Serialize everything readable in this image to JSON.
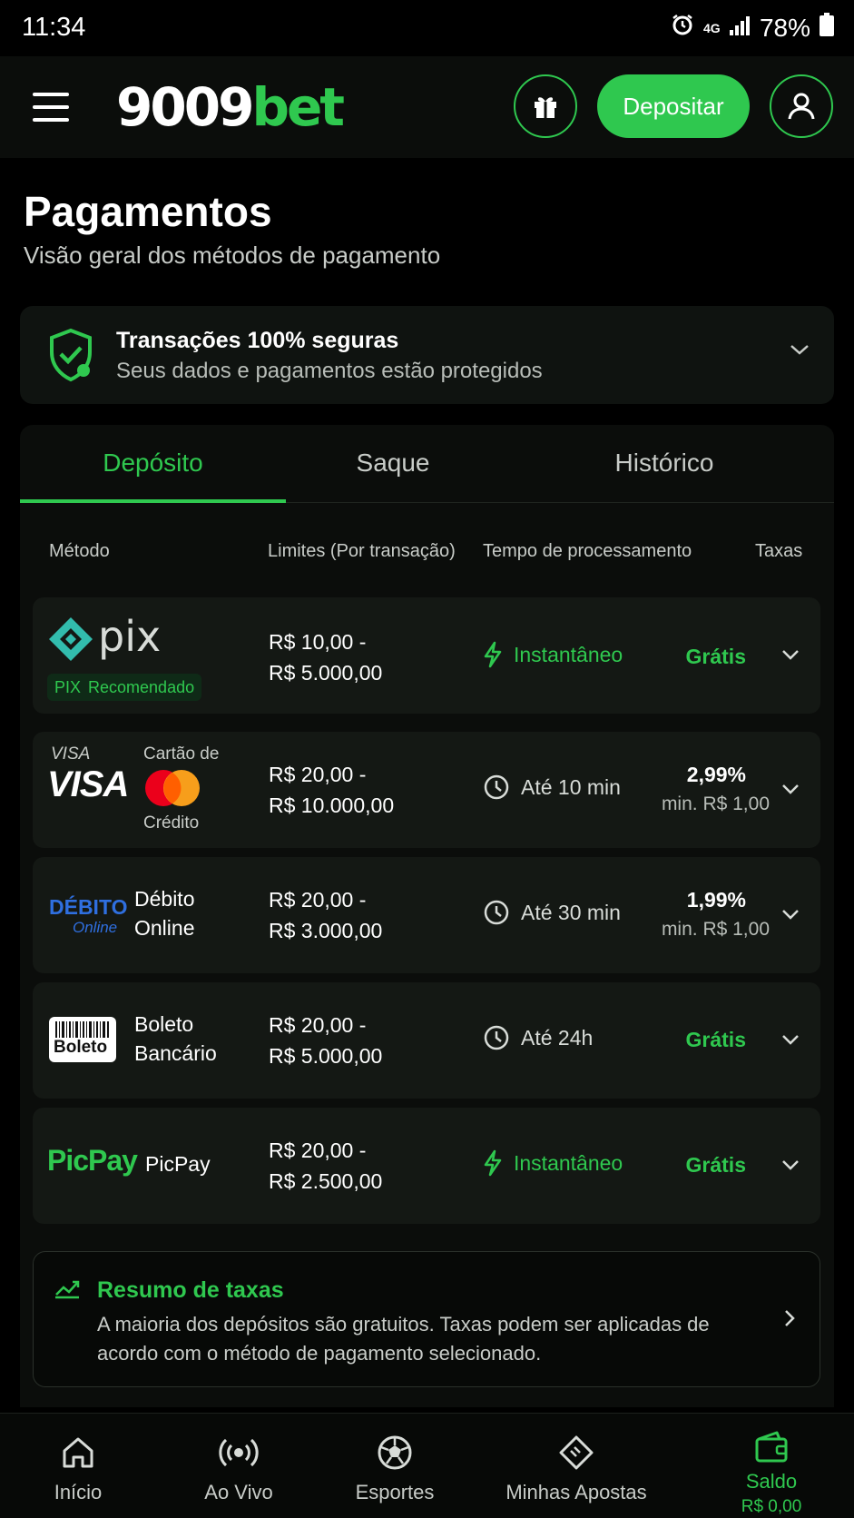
{
  "status_bar": {
    "time": "11:34",
    "network": "4G",
    "battery": "78%"
  },
  "header": {
    "logo_part1": "9009",
    "logo_part2": "bet",
    "deposit_label": "Depositar"
  },
  "page": {
    "title": "Pagamentos",
    "subtitle": "Visão geral dos métodos de pagamento"
  },
  "security": {
    "title": "Transações 100% seguras",
    "subtitle": "Seus dados e pagamentos estão protegidos"
  },
  "tabs": [
    {
      "label": "Depósito",
      "active": true
    },
    {
      "label": "Saque",
      "active": false
    },
    {
      "label": "Histórico",
      "active": false
    }
  ],
  "columns": {
    "method": "Método",
    "limits": "Limites (Por transação)",
    "time": "Tempo de processamento",
    "fees": "Taxas"
  },
  "methods": [
    {
      "logo_text": "pix",
      "badge_code": "PIX",
      "badge_label": "Recomendado",
      "limit_min": "R$ 10,00 -",
      "limit_max": "R$ 5.000,00",
      "time": "Instantâneo",
      "fee": "Grátis"
    },
    {
      "logo_small": "VISA",
      "logo_big": "VISA",
      "name_top": "Cartão de",
      "name_bottom": "Crédito",
      "limit_min": "R$ 20,00 -",
      "limit_max": "R$ 10.000,00",
      "time": "Até 10 min",
      "fee": "2,99%",
      "fee_min": "min. R$ 1,00"
    },
    {
      "logo_top": "DÉBITO",
      "logo_bottom": "Online",
      "name_line1": "Débito",
      "name_line2": "Online",
      "limit_min": "R$ 20,00 -",
      "limit_max": "R$ 3.000,00",
      "time": "Até 30 min",
      "fee": "1,99%",
      "fee_min": "min. R$ 1,00"
    },
    {
      "logo_text": "Boleto",
      "name_line1": "Boleto",
      "name_line2": "Bancário",
      "limit_min": "R$ 20,00 -",
      "limit_max": "R$ 5.000,00",
      "time": "Até 24h",
      "fee": "Grátis"
    },
    {
      "logo_text": "PicPay",
      "name": "PicPay",
      "limit_min": "R$ 20,00 -",
      "limit_max": "R$ 2.500,00",
      "time": "Instantâneo",
      "fee": "Grátis"
    }
  ],
  "fees_summary": {
    "title": "Resumo de taxas",
    "text": "A maioria dos depósitos são gratuitos. Taxas podem ser aplicadas de acordo com o método de pagamento selecionado."
  },
  "bottom_nav": [
    {
      "label": "Início",
      "icon": "home-icon"
    },
    {
      "label": "Ao Vivo",
      "icon": "live-icon"
    },
    {
      "label": "Esportes",
      "icon": "soccer-ball-icon"
    },
    {
      "label": "Minhas Apostas",
      "icon": "ticket-icon"
    },
    {
      "label": "Saldo",
      "icon": "wallet-icon",
      "active": true,
      "balance": "R$ 0,00"
    }
  ],
  "colors": {
    "accent": "#2fc84f",
    "background": "#000000",
    "card": "#141814"
  }
}
